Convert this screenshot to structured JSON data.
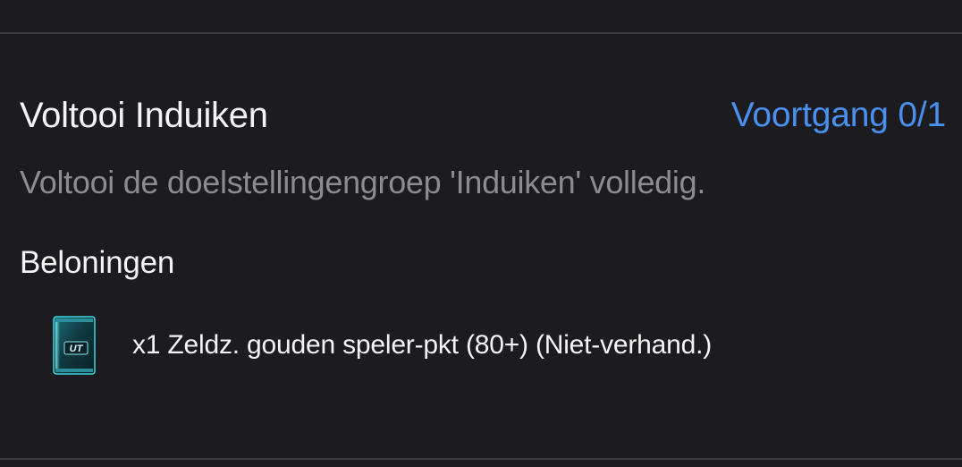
{
  "objective": {
    "title": "Voltooi Induiken",
    "progress": "Voortgang 0/1",
    "description": "Voltooi de doelstellingengroep 'Induiken' volledig."
  },
  "rewards": {
    "heading": "Beloningen",
    "items": [
      {
        "label": "x1 Zeldz. gouden speler-pkt (80+) (Niet-verhand.)",
        "icon": "ut-pack-icon",
        "icon_text": "UT"
      }
    ]
  },
  "colors": {
    "background": "#1c1b20",
    "progress_accent": "#4a90f0",
    "pack_accent": "#3fd3df"
  }
}
